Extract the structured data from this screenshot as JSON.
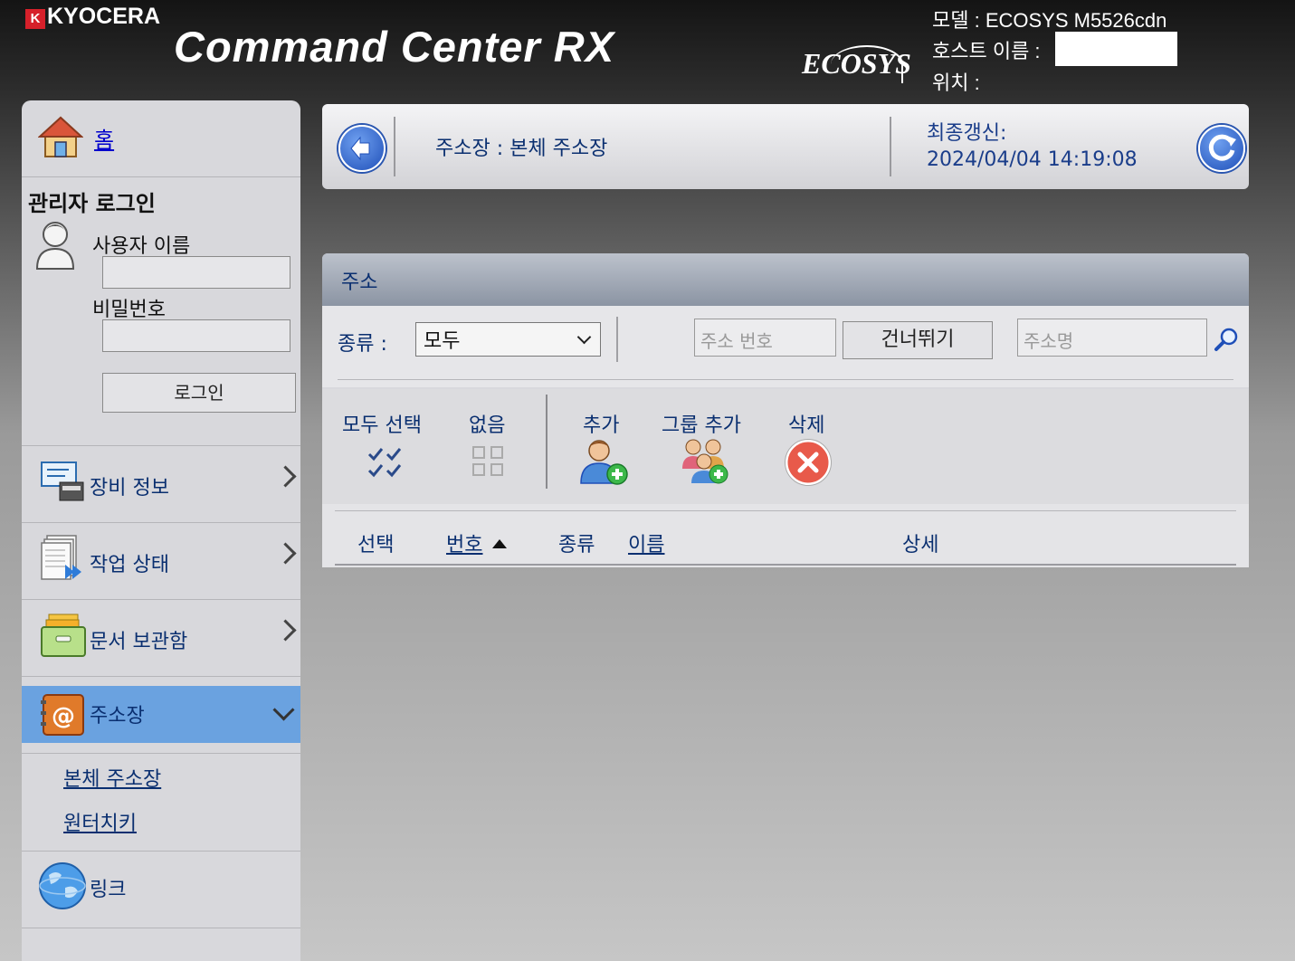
{
  "header": {
    "brand": "KYOCERA",
    "product": "Command Center RX",
    "ecosys": "ECOSYS",
    "model_label": "모델 : ECOSYS M5526cdn",
    "host_label": "호스트 이름 :",
    "location_label": "위치 :"
  },
  "sidebar": {
    "home": "홈",
    "login_title": "관리자 로그인",
    "username_label": "사용자 이름",
    "password_label": "비밀번호",
    "login_button": "로그인",
    "items": [
      {
        "label": "장비 정보",
        "icon": "device-info-icon"
      },
      {
        "label": "작업 상태",
        "icon": "job-status-icon"
      },
      {
        "label": "문서 보관함",
        "icon": "document-box-icon"
      },
      {
        "label": "주소장",
        "icon": "address-book-icon"
      },
      {
        "label": "링크",
        "icon": "globe-icon"
      }
    ],
    "sub_items": [
      "본체 주소장",
      "원터치키"
    ]
  },
  "top_panel": {
    "breadcrumb": "주소장 : 본체 주소장",
    "updated_label": "최종갱신:",
    "updated_value": "2024/04/04 14:19:08"
  },
  "address": {
    "title": "주소",
    "type_label": "종류 :",
    "type_selected": "모두",
    "number_placeholder": "주소 번호",
    "skip_button": "건너뛰기",
    "name_placeholder": "주소명",
    "actions": {
      "select_all": "모두 선택",
      "none": "없음",
      "add": "추가",
      "add_group": "그룹 추가",
      "delete": "삭제"
    },
    "columns": [
      "선택",
      "번호",
      "종류",
      "이름",
      "상세"
    ]
  },
  "colors": {
    "accent_active": "#6aa2e0",
    "link": "#0a2f70",
    "brand_red": "#d6202a"
  }
}
